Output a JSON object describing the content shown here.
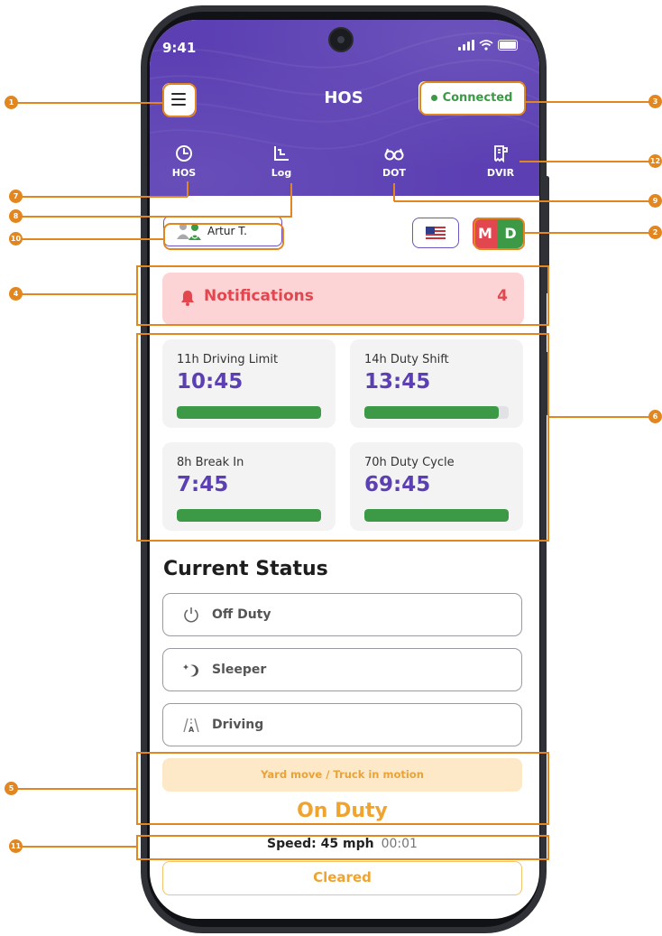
{
  "status_bar": {
    "time": "9:41"
  },
  "header": {
    "title": "HOS",
    "connection_status": "Connected"
  },
  "nav": {
    "items": [
      {
        "label": "HOS",
        "icon": "clock-icon"
      },
      {
        "label": "Log",
        "icon": "chart-log-icon"
      },
      {
        "label": "DOT",
        "icon": "glasses-icon"
      },
      {
        "label": "DVIR",
        "icon": "report-icon"
      }
    ]
  },
  "driver": {
    "name": "Artur T.",
    "flag": "us-flag-icon",
    "mode_left": "M",
    "mode_right": "D"
  },
  "notifications": {
    "label": "Notifications",
    "count": "4"
  },
  "timers": [
    {
      "title": "11h Driving Limit",
      "value": "10:45",
      "progress": 1.0
    },
    {
      "title": "14h Duty Shift",
      "value": "13:45",
      "progress": 0.93
    },
    {
      "title": "8h Break In",
      "value": "7:45",
      "progress": 1.0
    },
    {
      "title": "70h Duty Cycle",
      "value": "69:45",
      "progress": 1.0
    }
  ],
  "current_status": {
    "title": "Current Status",
    "options": [
      {
        "label": "Off Duty",
        "icon": "power-icon"
      },
      {
        "label": "Sleeper",
        "icon": "moon-icon"
      },
      {
        "label": "Driving",
        "icon": "road-icon"
      }
    ],
    "yard_move": "Yard move / Truck in motion",
    "active_status": "On Duty",
    "speed_label": "Speed: 45 mph",
    "speed_time": "00:01",
    "cleared_label": "Cleared"
  },
  "annotations": {
    "markers": [
      "1",
      "2",
      "3",
      "4",
      "5",
      "6",
      "7",
      "8",
      "9",
      "10",
      "11",
      "12"
    ]
  },
  "colors": {
    "header_bg": "#5b3fb3",
    "accent_orange": "#e2861f",
    "success_green": "#3c9a46",
    "alert_red": "#e2474f",
    "onduty_orange": "#f0a430"
  }
}
